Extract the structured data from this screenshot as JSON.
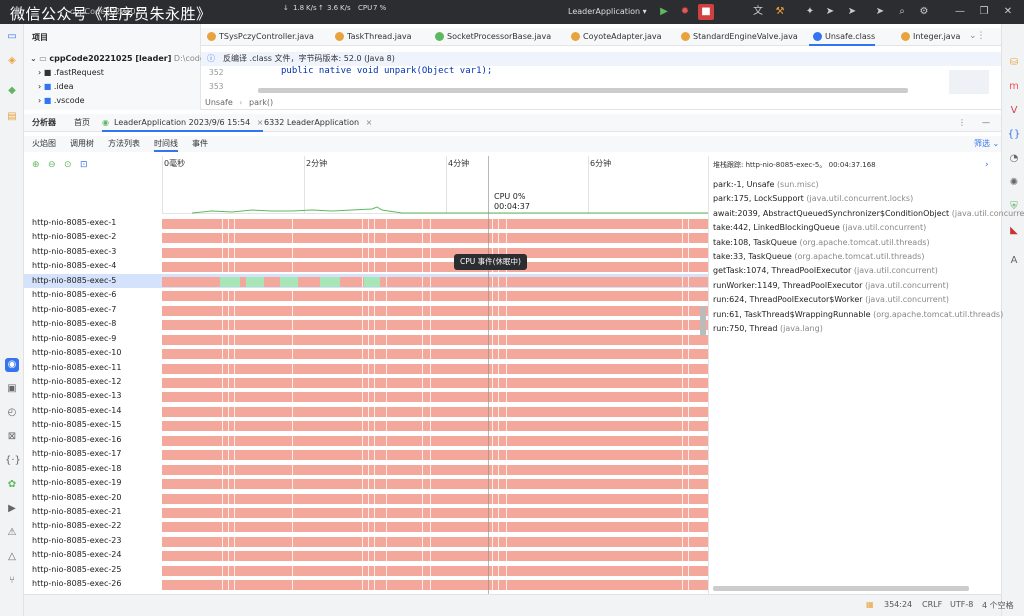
{
  "watermark": "微信公众号《程序员朱永胜》",
  "titlebar": {
    "project": "cppCode20221025",
    "net_down": "1.8",
    "net_down_unit": "K/s",
    "net_up": "3.6",
    "net_up_unit": "K/s",
    "cpu_label": "CPU",
    "cpu_value": "7 %",
    "run_config": "LeaderApplication"
  },
  "project_panel": {
    "header": "项目",
    "root": "cppCode20221025 [leader]",
    "root_path": "D:\\code\\",
    "items": [
      ".fastRequest",
      ".idea",
      ".vscode"
    ]
  },
  "editor": {
    "tabs": [
      {
        "label": "TSysPczyController.java",
        "icon_color": "#e8a33c"
      },
      {
        "label": "TaskThread.java",
        "icon_color": "#e8a33c"
      },
      {
        "label": "SocketProcessorBase.java",
        "icon_color": "#5fb85f"
      },
      {
        "label": "CoyoteAdapter.java",
        "icon_color": "#e8a33c"
      },
      {
        "label": "StandardEngineValve.java",
        "icon_color": "#e8a33c"
      },
      {
        "label": "Unsafe.class",
        "icon_color": "#3574f0"
      },
      {
        "label": "Integer.java",
        "icon_color": "#e8a33c"
      }
    ],
    "banner": "反编译 .class 文件，字节码版本: 52.0 (Java 8)",
    "line_numbers": [
      "352",
      "353"
    ],
    "code_line": "public native void unpark(Object var1);",
    "breadcrumb_class": "Unsafe",
    "breadcrumb_method": "park()"
  },
  "profiler": {
    "title": "分析器",
    "tabs": [
      {
        "label": "首页"
      },
      {
        "label": "LeaderApplication 2023/9/6 15:54"
      },
      {
        "label": "6332 LeaderApplication"
      }
    ],
    "view_tabs": [
      "火焰图",
      "调用树",
      "方法列表",
      "时间线",
      "事件"
    ],
    "filter_label": "筛选",
    "ticks": [
      "0毫秒",
      "2分钟",
      "4分钟",
      "6分钟"
    ],
    "cpu_readout": "CPU 0%",
    "cpu_time": "00:04:37",
    "tooltip": "CPU 事件(休眠中)",
    "threads": [
      "http-nio-8085-exec-1",
      "http-nio-8085-exec-2",
      "http-nio-8085-exec-3",
      "http-nio-8085-exec-4",
      "http-nio-8085-exec-5",
      "http-nio-8085-exec-6",
      "http-nio-8085-exec-7",
      "http-nio-8085-exec-8",
      "http-nio-8085-exec-9",
      "http-nio-8085-exec-10",
      "http-nio-8085-exec-11",
      "http-nio-8085-exec-12",
      "http-nio-8085-exec-13",
      "http-nio-8085-exec-14",
      "http-nio-8085-exec-15",
      "http-nio-8085-exec-16",
      "http-nio-8085-exec-17",
      "http-nio-8085-exec-18",
      "http-nio-8085-exec-19",
      "http-nio-8085-exec-20",
      "http-nio-8085-exec-21",
      "http-nio-8085-exec-22",
      "http-nio-8085-exec-23",
      "http-nio-8085-exec-24",
      "http-nio-8085-exec-25",
      "http-nio-8085-exec-26"
    ],
    "selected_thread": "http-nio-8085-exec-5",
    "stack_header": "堆栈跟踪: http-nio-8085-exec-5。 00:04:37.168",
    "stack_frames": [
      {
        "method": "park:-1, Unsafe",
        "pkg": "(sun.misc)"
      },
      {
        "method": "park:175, LockSupport",
        "pkg": "(java.util.concurrent.locks)"
      },
      {
        "method": "await:2039, AbstractQueuedSynchronizer$ConditionObject",
        "pkg": "(java.util.concurrent"
      },
      {
        "method": "take:442, LinkedBlockingQueue",
        "pkg": "(java.util.concurrent)"
      },
      {
        "method": "take:108, TaskQueue",
        "pkg": "(org.apache.tomcat.util.threads)"
      },
      {
        "method": "take:33, TaskQueue",
        "pkg": "(org.apache.tomcat.util.threads)"
      },
      {
        "method": "getTask:1074, ThreadPoolExecutor",
        "pkg": "(java.util.concurrent)"
      },
      {
        "method": "runWorker:1149, ThreadPoolExecutor",
        "pkg": "(java.util.concurrent)"
      },
      {
        "method": "run:624, ThreadPoolExecutor$Worker",
        "pkg": "(java.util.concurrent)"
      },
      {
        "method": "run:61, TaskThread$WrappingRunnable",
        "pkg": "(org.apache.tomcat.util.threads)"
      },
      {
        "method": "run:750, Thread",
        "pkg": "(java.lang)"
      }
    ]
  },
  "statusbar": {
    "position": "354:24",
    "line_ending": "CRLF",
    "encoding": "UTF-8",
    "indent": "4 个空格"
  },
  "colors": {
    "sleeping": "#f4a89b",
    "running": "#a8e6b8",
    "accent": "#3574f0"
  }
}
